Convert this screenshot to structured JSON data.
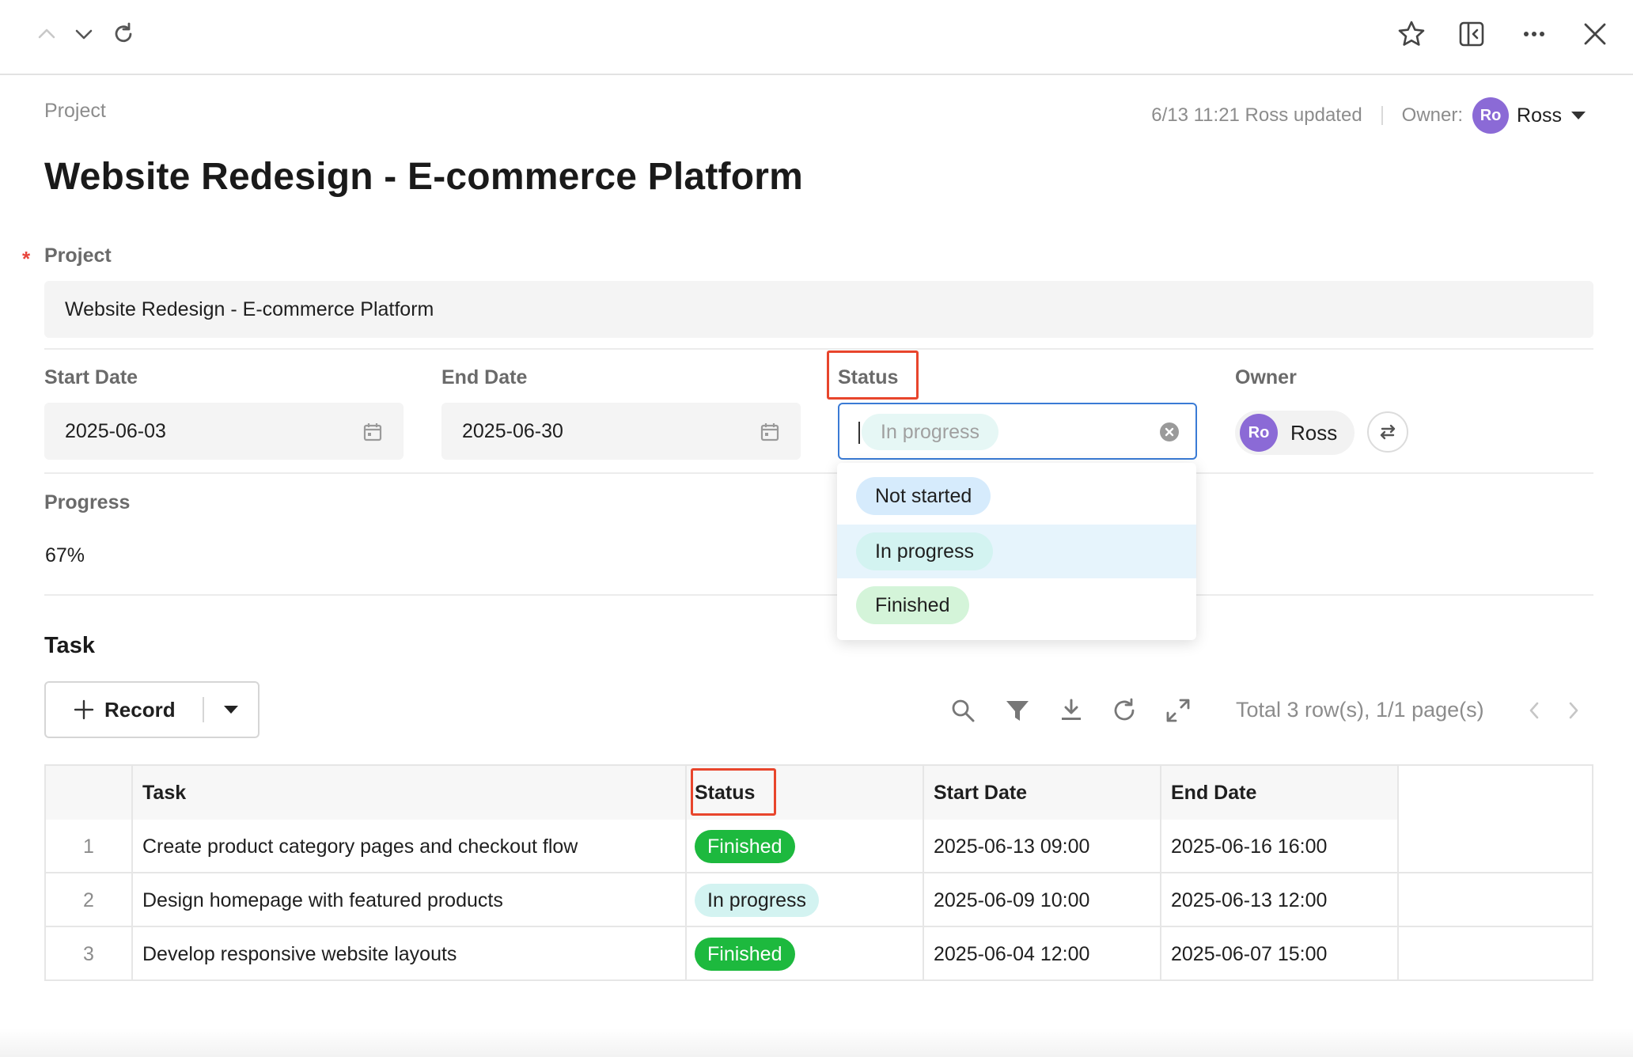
{
  "toolbar": {
    "icons": [
      "chevron-up-icon",
      "chevron-down-icon",
      "refresh-icon",
      "star-icon",
      "sidebar-collapse-icon",
      "more-icon",
      "close-icon"
    ]
  },
  "header": {
    "breadcrumb": "Project",
    "updated_text": "6/13 11:21 Ross updated",
    "owner_label": "Owner:",
    "owner_initials": "Ro",
    "owner_name": "Ross",
    "title": "Website Redesign - E-commerce Platform"
  },
  "form": {
    "project_label": "Project",
    "project_value": "Website Redesign - E-commerce Platform",
    "start_date_label": "Start Date",
    "start_date_value": "2025-06-03",
    "end_date_label": "End Date",
    "end_date_value": "2025-06-30",
    "status_label": "Status",
    "status_placeholder": "In progress",
    "owner_label": "Owner",
    "owner_initials": "Ro",
    "owner_name": "Ross",
    "progress_label": "Progress",
    "progress_value": "67%"
  },
  "status_dropdown": {
    "options": [
      {
        "label": "Not started",
        "color": "#d6ebfc"
      },
      {
        "label": "In progress",
        "color": "#d3f3f1",
        "selected": true
      },
      {
        "label": "Finished",
        "color": "#d4f4d9"
      }
    ]
  },
  "task_section": {
    "title": "Task",
    "record_button": "Record",
    "pager_text": "Total 3 row(s), 1/1 page(s)",
    "tools": [
      "search-icon",
      "filter-icon",
      "download-icon",
      "refresh-icon",
      "expand-icon"
    ]
  },
  "task_table": {
    "columns": [
      "Task",
      "Status",
      "Start Date",
      "End Date"
    ],
    "rows": [
      {
        "index": "1",
        "task": "Create product category pages and checkout flow",
        "status": "Finished",
        "start": "2025-06-13 09:00",
        "end": "2025-06-16 16:00"
      },
      {
        "index": "2",
        "task": "Design homepage with featured products",
        "status": "In progress",
        "start": "2025-06-09 10:00",
        "end": "2025-06-13 12:00"
      },
      {
        "index": "3",
        "task": "Develop responsive website layouts",
        "status": "Finished",
        "start": "2025-06-04 12:00",
        "end": "2025-06-07 15:00"
      }
    ]
  },
  "colors": {
    "accent_blue": "#3a7bd5",
    "highlight_red": "#e8452c",
    "finished_green": "#1db93e",
    "in_progress_teal": "#d3f3f1",
    "avatar_purple": "#8b6ad6"
  }
}
